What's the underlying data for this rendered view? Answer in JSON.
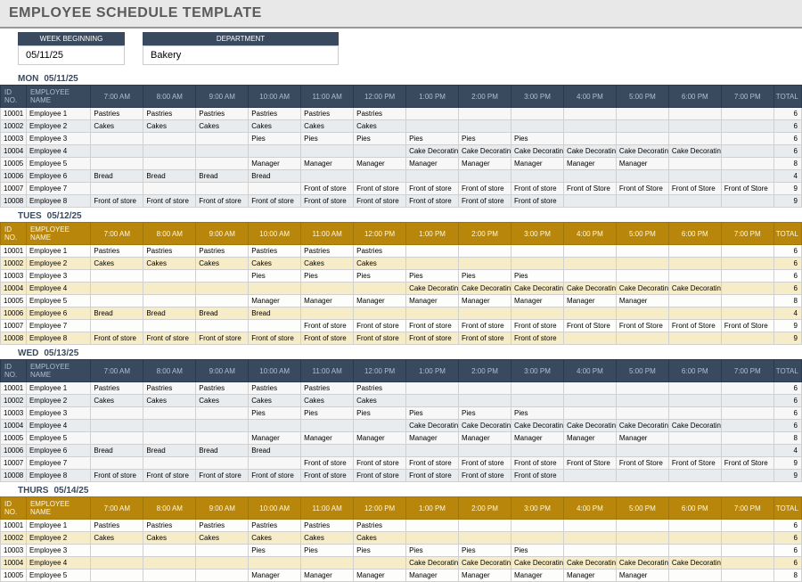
{
  "title": "EMPLOYEE SCHEDULE TEMPLATE",
  "meta": {
    "week_label": "WEEK BEGINNING",
    "week_value": "05/11/25",
    "dept_label": "DEPARTMENT",
    "dept_value": "Bakery"
  },
  "headers": {
    "id": "ID NO.",
    "name": "EMPLOYEE NAME",
    "total": "TOTAL",
    "hours": [
      "7:00 AM",
      "8:00 AM",
      "9:00 AM",
      "10:00 AM",
      "11:00 AM",
      "12:00 PM",
      "1:00 PM",
      "2:00 PM",
      "3:00 PM",
      "4:00 PM",
      "5:00 PM",
      "6:00 PM",
      "7:00 PM"
    ]
  },
  "days": [
    {
      "name": "MON",
      "date": "05/11/25",
      "theme": "gray",
      "header_style": "navy",
      "rows": [
        {
          "id": "10001",
          "name": "Employee 1",
          "cells": [
            "Pastries",
            "Pastries",
            "Pastries",
            "Pastries",
            "Pastries",
            "Pastries",
            "",
            "",
            "",
            "",
            "",
            "",
            ""
          ],
          "total": "6"
        },
        {
          "id": "10002",
          "name": "Employee 2",
          "cells": [
            "Cakes",
            "Cakes",
            "Cakes",
            "Cakes",
            "Cakes",
            "Cakes",
            "",
            "",
            "",
            "",
            "",
            "",
            ""
          ],
          "total": "6"
        },
        {
          "id": "10003",
          "name": "Employee 3",
          "cells": [
            "",
            "",
            "",
            "Pies",
            "Pies",
            "Pies",
            "Pies",
            "Pies",
            "Pies",
            "",
            "",
            "",
            ""
          ],
          "total": "6"
        },
        {
          "id": "10004",
          "name": "Employee 4",
          "cells": [
            "",
            "",
            "",
            "",
            "",
            "",
            "Cake Decorating",
            "Cake Decorating",
            "Cake Decorating",
            "Cake Decorating",
            "Cake Decorating",
            "Cake Decorating",
            ""
          ],
          "total": "6"
        },
        {
          "id": "10005",
          "name": "Employee 5",
          "cells": [
            "",
            "",
            "",
            "Manager",
            "Manager",
            "Manager",
            "Manager",
            "Manager",
            "Manager",
            "Manager",
            "Manager",
            "",
            ""
          ],
          "total": "8"
        },
        {
          "id": "10006",
          "name": "Employee 6",
          "cells": [
            "Bread",
            "Bread",
            "Bread",
            "Bread",
            "",
            "",
            "",
            "",
            "",
            "",
            "",
            "",
            ""
          ],
          "total": "4"
        },
        {
          "id": "10007",
          "name": "Employee 7",
          "cells": [
            "",
            "",
            "",
            "",
            "Front of store",
            "Front of store",
            "Front of store",
            "Front of store",
            "Front of store",
            "Front of Store",
            "Front of Store",
            "Front of Store",
            "Front of Store"
          ],
          "total": "9"
        },
        {
          "id": "10008",
          "name": "Employee 8",
          "cells": [
            "Front of store",
            "Front of store",
            "Front of store",
            "Front of store",
            "Front of store",
            "Front of store",
            "Front of store",
            "Front of store",
            "Front of store",
            "",
            "",
            "",
            ""
          ],
          "total": "9"
        }
      ]
    },
    {
      "name": "TUES",
      "date": "05/12/25",
      "theme": "gold",
      "header_style": "gold",
      "rows": [
        {
          "id": "10001",
          "name": "Employee 1",
          "cells": [
            "Pastries",
            "Pastries",
            "Pastries",
            "Pastries",
            "Pastries",
            "Pastries",
            "",
            "",
            "",
            "",
            "",
            "",
            ""
          ],
          "total": "6"
        },
        {
          "id": "10002",
          "name": "Employee 2",
          "cells": [
            "Cakes",
            "Cakes",
            "Cakes",
            "Cakes",
            "Cakes",
            "Cakes",
            "",
            "",
            "",
            "",
            "",
            "",
            ""
          ],
          "total": "6"
        },
        {
          "id": "10003",
          "name": "Employee 3",
          "cells": [
            "",
            "",
            "",
            "Pies",
            "Pies",
            "Pies",
            "Pies",
            "Pies",
            "Pies",
            "",
            "",
            "",
            ""
          ],
          "total": "6"
        },
        {
          "id": "10004",
          "name": "Employee 4",
          "cells": [
            "",
            "",
            "",
            "",
            "",
            "",
            "Cake Decorating",
            "Cake Decorating",
            "Cake Decorating",
            "Cake Decorating",
            "Cake Decorating",
            "Cake Decorating",
            ""
          ],
          "total": "6"
        },
        {
          "id": "10005",
          "name": "Employee 5",
          "cells": [
            "",
            "",
            "",
            "Manager",
            "Manager",
            "Manager",
            "Manager",
            "Manager",
            "Manager",
            "Manager",
            "Manager",
            "",
            ""
          ],
          "total": "8"
        },
        {
          "id": "10006",
          "name": "Employee 6",
          "cells": [
            "Bread",
            "Bread",
            "Bread",
            "Bread",
            "",
            "",
            "",
            "",
            "",
            "",
            "",
            "",
            ""
          ],
          "total": "4"
        },
        {
          "id": "10007",
          "name": "Employee 7",
          "cells": [
            "",
            "",
            "",
            "",
            "Front of store",
            "Front of store",
            "Front of store",
            "Front of store",
            "Front of store",
            "Front of Store",
            "Front of Store",
            "Front of Store",
            "Front of Store"
          ],
          "total": "9"
        },
        {
          "id": "10008",
          "name": "Employee 8",
          "cells": [
            "Front of store",
            "Front of store",
            "Front of store",
            "Front of store",
            "Front of store",
            "Front of store",
            "Front of store",
            "Front of store",
            "Front of store",
            "",
            "",
            "",
            ""
          ],
          "total": "9"
        }
      ]
    },
    {
      "name": "WED",
      "date": "05/13/25",
      "theme": "gray",
      "header_style": "navy",
      "rows": [
        {
          "id": "10001",
          "name": "Employee 1",
          "cells": [
            "Pastries",
            "Pastries",
            "Pastries",
            "Pastries",
            "Pastries",
            "Pastries",
            "",
            "",
            "",
            "",
            "",
            "",
            ""
          ],
          "total": "6"
        },
        {
          "id": "10002",
          "name": "Employee 2",
          "cells": [
            "Cakes",
            "Cakes",
            "Cakes",
            "Cakes",
            "Cakes",
            "Cakes",
            "",
            "",
            "",
            "",
            "",
            "",
            ""
          ],
          "total": "6"
        },
        {
          "id": "10003",
          "name": "Employee 3",
          "cells": [
            "",
            "",
            "",
            "Pies",
            "Pies",
            "Pies",
            "Pies",
            "Pies",
            "Pies",
            "",
            "",
            "",
            ""
          ],
          "total": "6"
        },
        {
          "id": "10004",
          "name": "Employee 4",
          "cells": [
            "",
            "",
            "",
            "",
            "",
            "",
            "Cake Decorating",
            "Cake Decorating",
            "Cake Decorating",
            "Cake Decorating",
            "Cake Decorating",
            "Cake Decorating",
            ""
          ],
          "total": "6"
        },
        {
          "id": "10005",
          "name": "Employee 5",
          "cells": [
            "",
            "",
            "",
            "Manager",
            "Manager",
            "Manager",
            "Manager",
            "Manager",
            "Manager",
            "Manager",
            "Manager",
            "",
            ""
          ],
          "total": "8"
        },
        {
          "id": "10006",
          "name": "Employee 6",
          "cells": [
            "Bread",
            "Bread",
            "Bread",
            "Bread",
            "",
            "",
            "",
            "",
            "",
            "",
            "",
            "",
            ""
          ],
          "total": "4"
        },
        {
          "id": "10007",
          "name": "Employee 7",
          "cells": [
            "",
            "",
            "",
            "",
            "Front of store",
            "Front of store",
            "Front of store",
            "Front of store",
            "Front of store",
            "Front of Store",
            "Front of Store",
            "Front of Store",
            "Front of Store"
          ],
          "total": "9"
        },
        {
          "id": "10008",
          "name": "Employee 8",
          "cells": [
            "Front of store",
            "Front of store",
            "Front of store",
            "Front of store",
            "Front of store",
            "Front of store",
            "Front of store",
            "Front of store",
            "Front of store",
            "",
            "",
            "",
            ""
          ],
          "total": "9"
        }
      ]
    },
    {
      "name": "THURS",
      "date": "05/14/25",
      "theme": "gold",
      "header_style": "gold",
      "rows": [
        {
          "id": "10001",
          "name": "Employee 1",
          "cells": [
            "Pastries",
            "Pastries",
            "Pastries",
            "Pastries",
            "Pastries",
            "Pastries",
            "",
            "",
            "",
            "",
            "",
            "",
            ""
          ],
          "total": "6"
        },
        {
          "id": "10002",
          "name": "Employee 2",
          "cells": [
            "Cakes",
            "Cakes",
            "Cakes",
            "Cakes",
            "Cakes",
            "Cakes",
            "",
            "",
            "",
            "",
            "",
            "",
            ""
          ],
          "total": "6"
        },
        {
          "id": "10003",
          "name": "Employee 3",
          "cells": [
            "",
            "",
            "",
            "Pies",
            "Pies",
            "Pies",
            "Pies",
            "Pies",
            "Pies",
            "",
            "",
            "",
            ""
          ],
          "total": "6"
        },
        {
          "id": "10004",
          "name": "Employee 4",
          "cells": [
            "",
            "",
            "",
            "",
            "",
            "",
            "Cake Decorating",
            "Cake Decorating",
            "Cake Decorating",
            "Cake Decorating",
            "Cake Decorating",
            "Cake Decorating",
            ""
          ],
          "total": "6"
        },
        {
          "id": "10005",
          "name": "Employee 5",
          "cells": [
            "",
            "",
            "",
            "Manager",
            "Manager",
            "Manager",
            "Manager",
            "Manager",
            "Manager",
            "Manager",
            "Manager",
            "",
            ""
          ],
          "total": "8"
        }
      ]
    }
  ]
}
